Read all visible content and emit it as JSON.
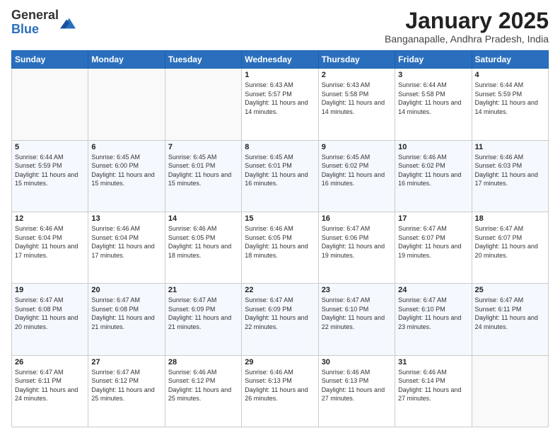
{
  "logo": {
    "general": "General",
    "blue": "Blue"
  },
  "header": {
    "month": "January 2025",
    "location": "Banganapalle, Andhra Pradesh, India"
  },
  "weekdays": [
    "Sunday",
    "Monday",
    "Tuesday",
    "Wednesday",
    "Thursday",
    "Friday",
    "Saturday"
  ],
  "weeks": [
    [
      {
        "day": "",
        "info": ""
      },
      {
        "day": "",
        "info": ""
      },
      {
        "day": "",
        "info": ""
      },
      {
        "day": "1",
        "info": "Sunrise: 6:43 AM\nSunset: 5:57 PM\nDaylight: 11 hours and 14 minutes."
      },
      {
        "day": "2",
        "info": "Sunrise: 6:43 AM\nSunset: 5:58 PM\nDaylight: 11 hours and 14 minutes."
      },
      {
        "day": "3",
        "info": "Sunrise: 6:44 AM\nSunset: 5:58 PM\nDaylight: 11 hours and 14 minutes."
      },
      {
        "day": "4",
        "info": "Sunrise: 6:44 AM\nSunset: 5:59 PM\nDaylight: 11 hours and 14 minutes."
      }
    ],
    [
      {
        "day": "5",
        "info": "Sunrise: 6:44 AM\nSunset: 5:59 PM\nDaylight: 11 hours and 15 minutes."
      },
      {
        "day": "6",
        "info": "Sunrise: 6:45 AM\nSunset: 6:00 PM\nDaylight: 11 hours and 15 minutes."
      },
      {
        "day": "7",
        "info": "Sunrise: 6:45 AM\nSunset: 6:01 PM\nDaylight: 11 hours and 15 minutes."
      },
      {
        "day": "8",
        "info": "Sunrise: 6:45 AM\nSunset: 6:01 PM\nDaylight: 11 hours and 16 minutes."
      },
      {
        "day": "9",
        "info": "Sunrise: 6:45 AM\nSunset: 6:02 PM\nDaylight: 11 hours and 16 minutes."
      },
      {
        "day": "10",
        "info": "Sunrise: 6:46 AM\nSunset: 6:02 PM\nDaylight: 11 hours and 16 minutes."
      },
      {
        "day": "11",
        "info": "Sunrise: 6:46 AM\nSunset: 6:03 PM\nDaylight: 11 hours and 17 minutes."
      }
    ],
    [
      {
        "day": "12",
        "info": "Sunrise: 6:46 AM\nSunset: 6:04 PM\nDaylight: 11 hours and 17 minutes."
      },
      {
        "day": "13",
        "info": "Sunrise: 6:46 AM\nSunset: 6:04 PM\nDaylight: 11 hours and 17 minutes."
      },
      {
        "day": "14",
        "info": "Sunrise: 6:46 AM\nSunset: 6:05 PM\nDaylight: 11 hours and 18 minutes."
      },
      {
        "day": "15",
        "info": "Sunrise: 6:46 AM\nSunset: 6:05 PM\nDaylight: 11 hours and 18 minutes."
      },
      {
        "day": "16",
        "info": "Sunrise: 6:47 AM\nSunset: 6:06 PM\nDaylight: 11 hours and 19 minutes."
      },
      {
        "day": "17",
        "info": "Sunrise: 6:47 AM\nSunset: 6:07 PM\nDaylight: 11 hours and 19 minutes."
      },
      {
        "day": "18",
        "info": "Sunrise: 6:47 AM\nSunset: 6:07 PM\nDaylight: 11 hours and 20 minutes."
      }
    ],
    [
      {
        "day": "19",
        "info": "Sunrise: 6:47 AM\nSunset: 6:08 PM\nDaylight: 11 hours and 20 minutes."
      },
      {
        "day": "20",
        "info": "Sunrise: 6:47 AM\nSunset: 6:08 PM\nDaylight: 11 hours and 21 minutes."
      },
      {
        "day": "21",
        "info": "Sunrise: 6:47 AM\nSunset: 6:09 PM\nDaylight: 11 hours and 21 minutes."
      },
      {
        "day": "22",
        "info": "Sunrise: 6:47 AM\nSunset: 6:09 PM\nDaylight: 11 hours and 22 minutes."
      },
      {
        "day": "23",
        "info": "Sunrise: 6:47 AM\nSunset: 6:10 PM\nDaylight: 11 hours and 22 minutes."
      },
      {
        "day": "24",
        "info": "Sunrise: 6:47 AM\nSunset: 6:10 PM\nDaylight: 11 hours and 23 minutes."
      },
      {
        "day": "25",
        "info": "Sunrise: 6:47 AM\nSunset: 6:11 PM\nDaylight: 11 hours and 24 minutes."
      }
    ],
    [
      {
        "day": "26",
        "info": "Sunrise: 6:47 AM\nSunset: 6:11 PM\nDaylight: 11 hours and 24 minutes."
      },
      {
        "day": "27",
        "info": "Sunrise: 6:47 AM\nSunset: 6:12 PM\nDaylight: 11 hours and 25 minutes."
      },
      {
        "day": "28",
        "info": "Sunrise: 6:46 AM\nSunset: 6:12 PM\nDaylight: 11 hours and 25 minutes."
      },
      {
        "day": "29",
        "info": "Sunrise: 6:46 AM\nSunset: 6:13 PM\nDaylight: 11 hours and 26 minutes."
      },
      {
        "day": "30",
        "info": "Sunrise: 6:46 AM\nSunset: 6:13 PM\nDaylight: 11 hours and 27 minutes."
      },
      {
        "day": "31",
        "info": "Sunrise: 6:46 AM\nSunset: 6:14 PM\nDaylight: 11 hours and 27 minutes."
      },
      {
        "day": "",
        "info": ""
      }
    ]
  ]
}
